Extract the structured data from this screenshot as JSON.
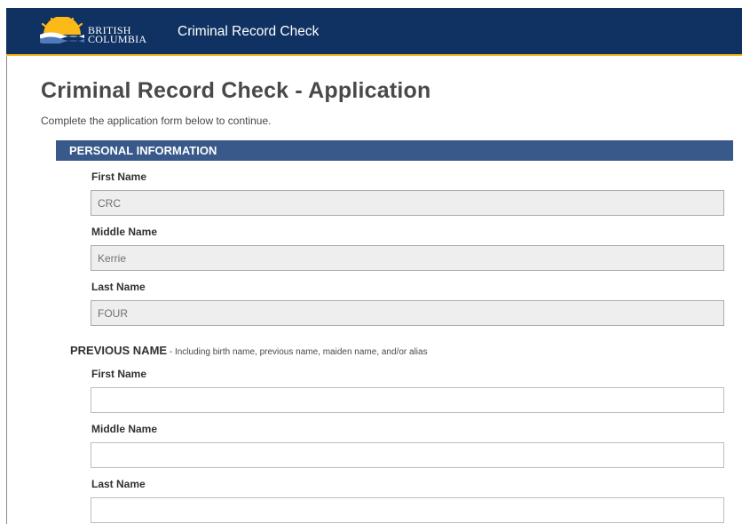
{
  "header": {
    "logo_line1": "BRITISH",
    "logo_line2": "COLUMBIA",
    "app_title": "Criminal Record Check",
    "colors": {
      "bar": "#0f3262",
      "accent": "#fcba19"
    }
  },
  "page": {
    "title": "Criminal Record Check - Application",
    "intro": "Complete the application form below to continue."
  },
  "personal": {
    "section_title": "PERSONAL INFORMATION",
    "first_name_label": "First Name",
    "first_name_value": "CRC",
    "middle_name_label": "Middle Name",
    "middle_name_value": "Kerrie",
    "last_name_label": "Last Name",
    "last_name_value": "FOUR"
  },
  "previous": {
    "heading": "PREVIOUS NAME",
    "note": " - Including birth name, previous name, maiden name, and/or alias",
    "first_name_label": "First Name",
    "first_name_value": "",
    "middle_name_label": "Middle Name",
    "middle_name_value": "",
    "last_name_label": "Last Name",
    "last_name_value": ""
  }
}
